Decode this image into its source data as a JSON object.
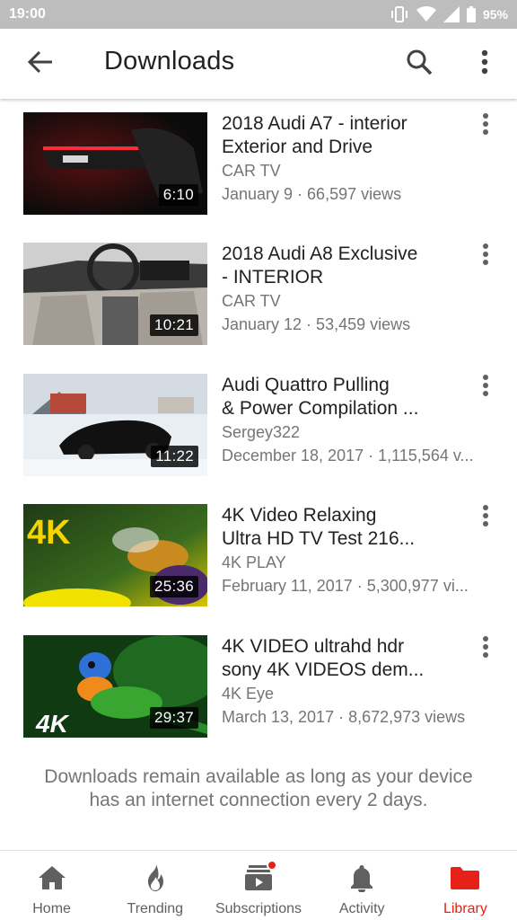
{
  "status_bar": {
    "time": "19:00",
    "battery": "95%",
    "icons": [
      "vibrate-icon",
      "wifi-icon",
      "cell-signal-icon",
      "battery-icon"
    ]
  },
  "app_bar": {
    "title": "Downloads",
    "icons": {
      "back": "arrow-back-icon",
      "search": "search-icon",
      "menu": "more-vert-icon"
    }
  },
  "videos": [
    {
      "title_line1": "2018 Audi A7 - interior",
      "title_line2": "Exterior and Drive",
      "channel": "CAR TV",
      "meta": "January 9 · 66,597 views",
      "duration": "6:10"
    },
    {
      "title_line1": "2018 Audi A8 Exclusive",
      "title_line2": "- INTERIOR",
      "channel": "CAR TV",
      "meta": "January 12 · 53,459 views",
      "duration": "10:21"
    },
    {
      "title_line1": "Audi Quattro Pulling",
      "title_line2": "& Power Compilation ...",
      "channel": "Sergey322",
      "meta": "December 18, 2017 · 1,115,564 v...",
      "duration": "11:22"
    },
    {
      "title_line1": "4K Video Relaxing",
      "title_line2": "Ultra HD TV Test 216...",
      "channel": "4K PLAY",
      "meta": "February 11, 2017 · 5,300,977 vi...",
      "duration": "25:36",
      "thumb_text": "4K"
    },
    {
      "title_line1": "4K VIDEO ultrahd hdr",
      "title_line2": "sony 4K VIDEOS dem...",
      "channel": "4K Eye",
      "meta": "March 13, 2017 · 8,672,973 views",
      "duration": "29:37",
      "thumb_text": "4K"
    }
  ],
  "notice": {
    "line1": "Downloads remain available as long as your device",
    "line2": "has an internet connection every 2 days."
  },
  "bottom_nav": {
    "items": [
      {
        "label": "Home",
        "icon": "home-icon"
      },
      {
        "label": "Trending",
        "icon": "flame-icon"
      },
      {
        "label": "Subscriptions",
        "icon": "subscriptions-icon"
      },
      {
        "label": "Activity",
        "icon": "bell-icon"
      },
      {
        "label": "Library",
        "icon": "folder-icon",
        "active": true
      }
    ]
  },
  "colors": {
    "accent": "#e62117",
    "status_bar": "#bdbdbd",
    "secondary_text": "#757575"
  }
}
